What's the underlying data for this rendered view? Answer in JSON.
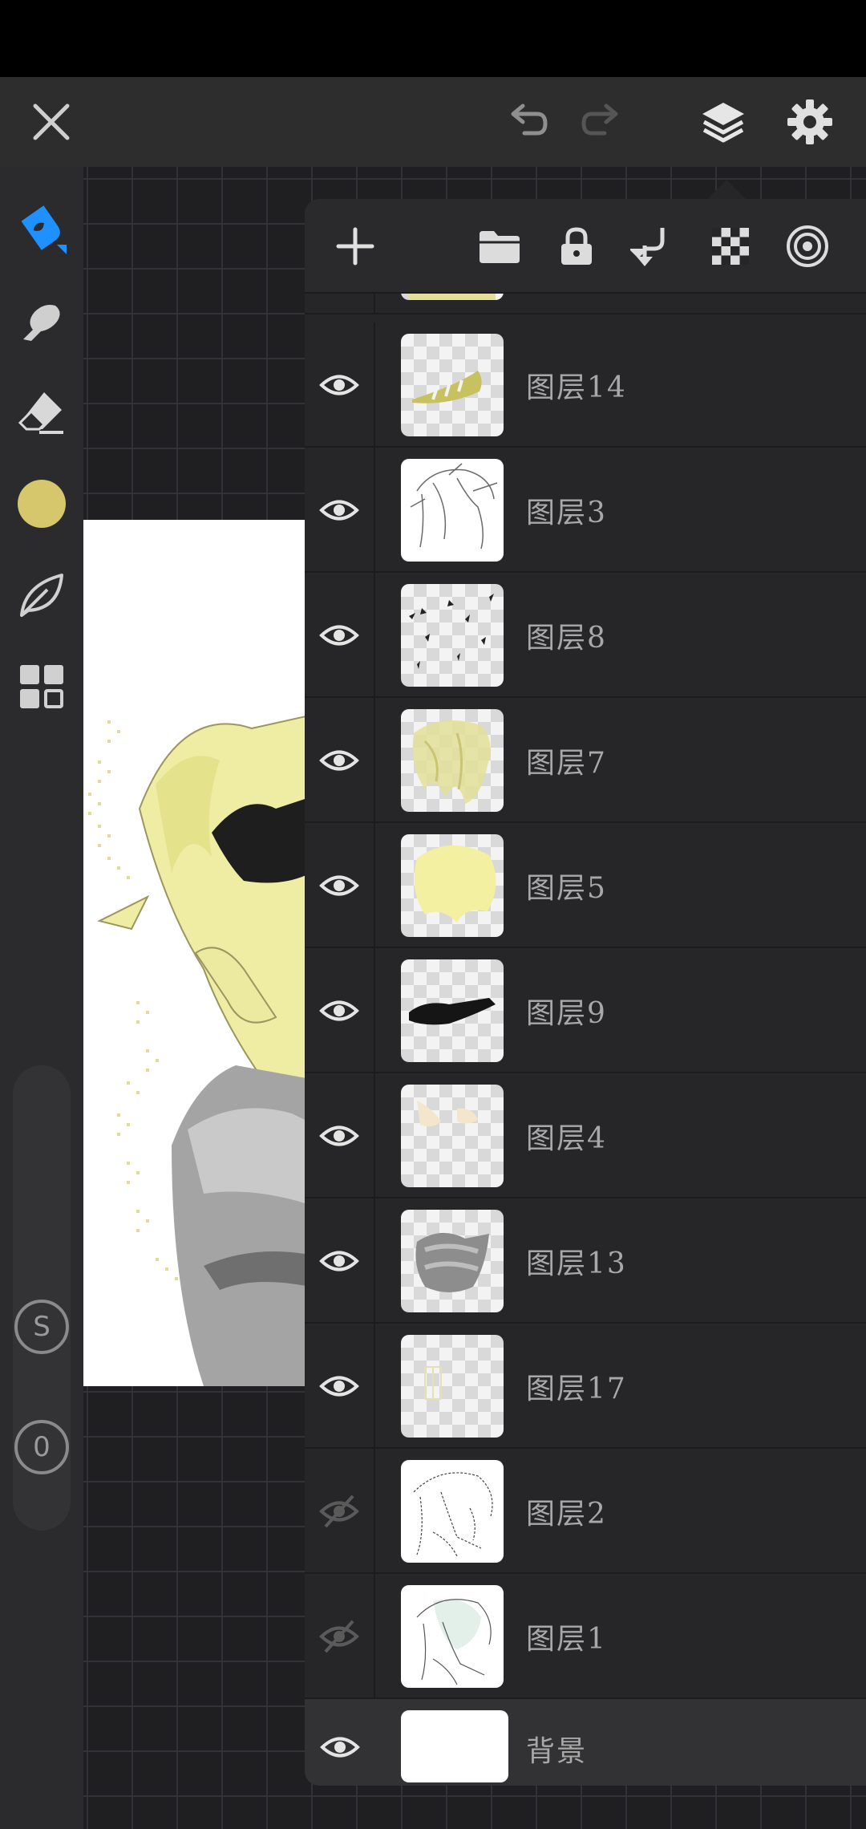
{
  "top_bar": {
    "close_icon": "close-icon",
    "undo_icon": "undo-icon",
    "redo_icon": "redo-icon",
    "layers_icon": "layers-icon",
    "settings_icon": "gear-icon"
  },
  "toolbar": {
    "tools": [
      "pen-tool-icon",
      "smudge-tool-icon",
      "eraser-tool-icon",
      "color-swatch",
      "leaf-tool-icon",
      "grid-menu-icon"
    ],
    "color": "#d6c66c",
    "size_badge": "S",
    "opacity_badge": "0"
  },
  "layers_panel": {
    "toolbar_icons": [
      "add-layer-icon",
      "folder-icon",
      "lock-icon",
      "merge-down-icon",
      "transparency-icon",
      "blend-target-icon"
    ],
    "layers": [
      {
        "name": "图层14",
        "visible": true
      },
      {
        "name": "图层3",
        "visible": true
      },
      {
        "name": "图层8",
        "visible": true
      },
      {
        "name": "图层7",
        "visible": true
      },
      {
        "name": "图层5",
        "visible": true
      },
      {
        "name": "图层9",
        "visible": true
      },
      {
        "name": "图层4",
        "visible": true
      },
      {
        "name": "图层13",
        "visible": true
      },
      {
        "name": "图层17",
        "visible": true
      },
      {
        "name": "图层2",
        "visible": false
      },
      {
        "name": "图层1",
        "visible": false
      }
    ],
    "background_layer": {
      "name": "背景",
      "visible": true
    }
  },
  "colors": {
    "accent_blue": "#1e90ff",
    "panel_bg": "#262628",
    "hair_yellow": "#e6e39a"
  }
}
